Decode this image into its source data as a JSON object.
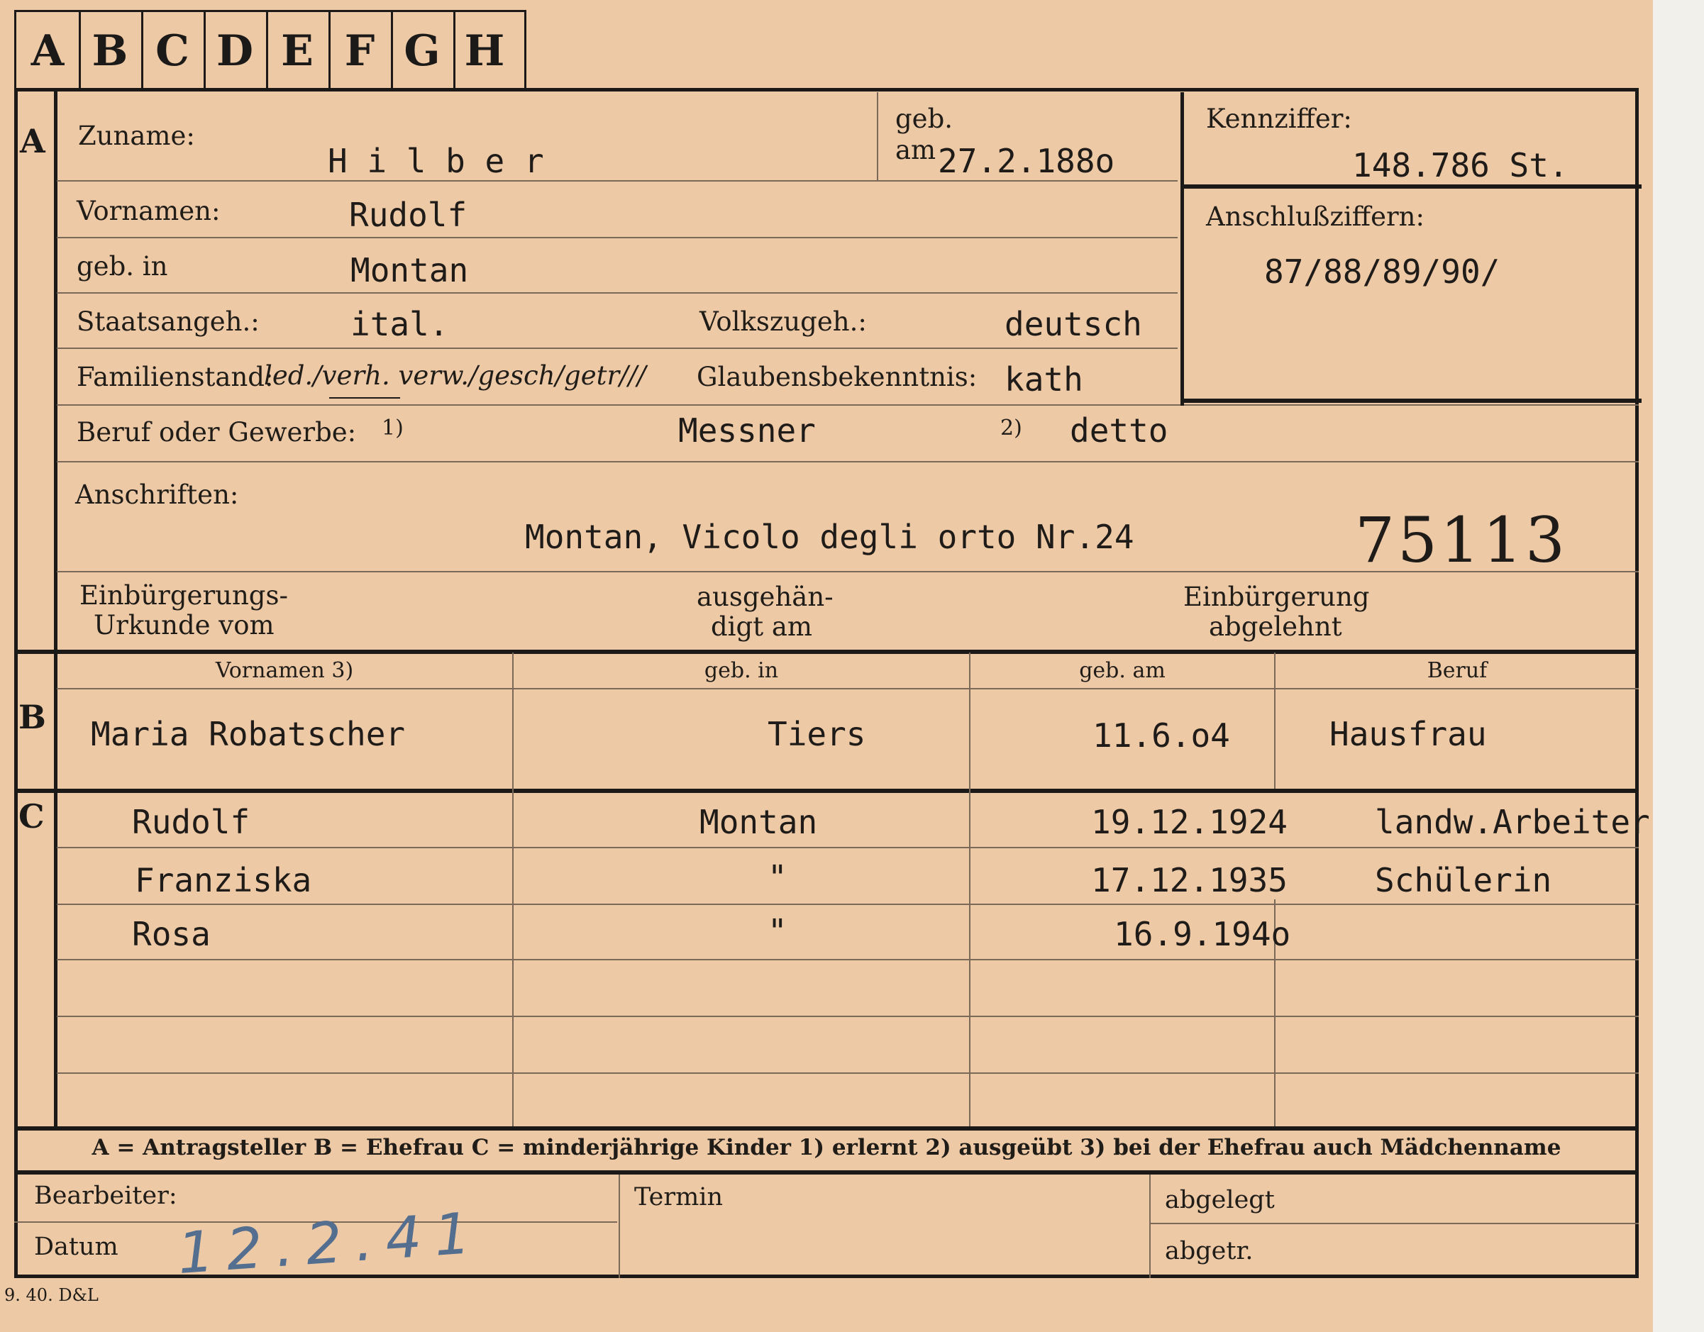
{
  "tabs": [
    "A",
    "B",
    "C",
    "D",
    "E",
    "F",
    "G",
    "H"
  ],
  "section_a": {
    "letter": "A",
    "zuname_label": "Zuname:",
    "zuname_value": "H i l b e r",
    "geb_am_label_1": "geb.",
    "geb_am_label_2": "am",
    "geb_am_value": "27.2.188o",
    "vornamen_label": "Vornamen:",
    "vornamen_value": "Rudolf",
    "geb_in_label": "geb. in",
    "geb_in_value": "Montan",
    "staatsangeh_label": "Staatsangeh.:",
    "staatsangeh_value": "ital.",
    "volkszugeh_label": "Volkszugeh.:",
    "volkszugeh_value": "deutsch",
    "familienstand_label": "Familienstand:",
    "familienstand_options": "led./verh. verw./gesch/getr///",
    "glaubensbekenntnis_label": "Glaubensbekenntnis:",
    "glaubensbekenntnis_value": "kath",
    "beruf_label": "Beruf oder Gewerbe:",
    "beruf_note_1": "1)",
    "beruf_value_1": "Messner",
    "beruf_note_2": "2)",
    "beruf_value_2": "detto",
    "anschriften_label": "Anschriften:",
    "anschriften_value": "Montan, Vicolo degli orto Nr.24",
    "stamp_number": "75113",
    "einbuergerung_label_1": "Einbürgerungs-",
    "einbuergerung_label_2": "Urkunde vom",
    "ausgehaendigt_label_1": "ausgehän-",
    "ausgehaendigt_label_2": "digt am",
    "abgelehnt_label_1": "Einbürgerung",
    "abgelehnt_label_2": "abgelehnt"
  },
  "kennziffer": {
    "label": "Kennziffer:",
    "value": "148.786 St.",
    "anschluss_label": "Anschlußziffern:",
    "anschluss_value": "87/88/89/90/"
  },
  "section_b": {
    "letter": "B",
    "headers": [
      "Vornamen 3)",
      "geb. in",
      "geb. am",
      "Beruf"
    ],
    "row": [
      "Maria Robatscher",
      "Tiers",
      "11.6.o4",
      "Hausfrau"
    ]
  },
  "section_c": {
    "letter": "C",
    "rows": [
      [
        "Rudolf",
        "Montan",
        "19.12.1924",
        "landw.Arbeiter"
      ],
      [
        "Franziska",
        "\"",
        "17.12.1935",
        "Schülerin"
      ],
      [
        "Rosa",
        "\"",
        "16.9.194o",
        ""
      ]
    ]
  },
  "legend": "A = Antragsteller   B = Ehefrau   C = minderjährige Kinder   1) erlernt   2) ausgeübt   3) bei der Ehefrau auch Mädchenname",
  "footer": {
    "bearbeiter_label": "Bearbeiter:",
    "datum_label": "Datum",
    "datum_value": "12.2.41",
    "termin_label": "Termin",
    "abgelegt_label": "abgelegt",
    "abgetr_label": "abgetr.",
    "print_code": "9. 40. D&L"
  }
}
